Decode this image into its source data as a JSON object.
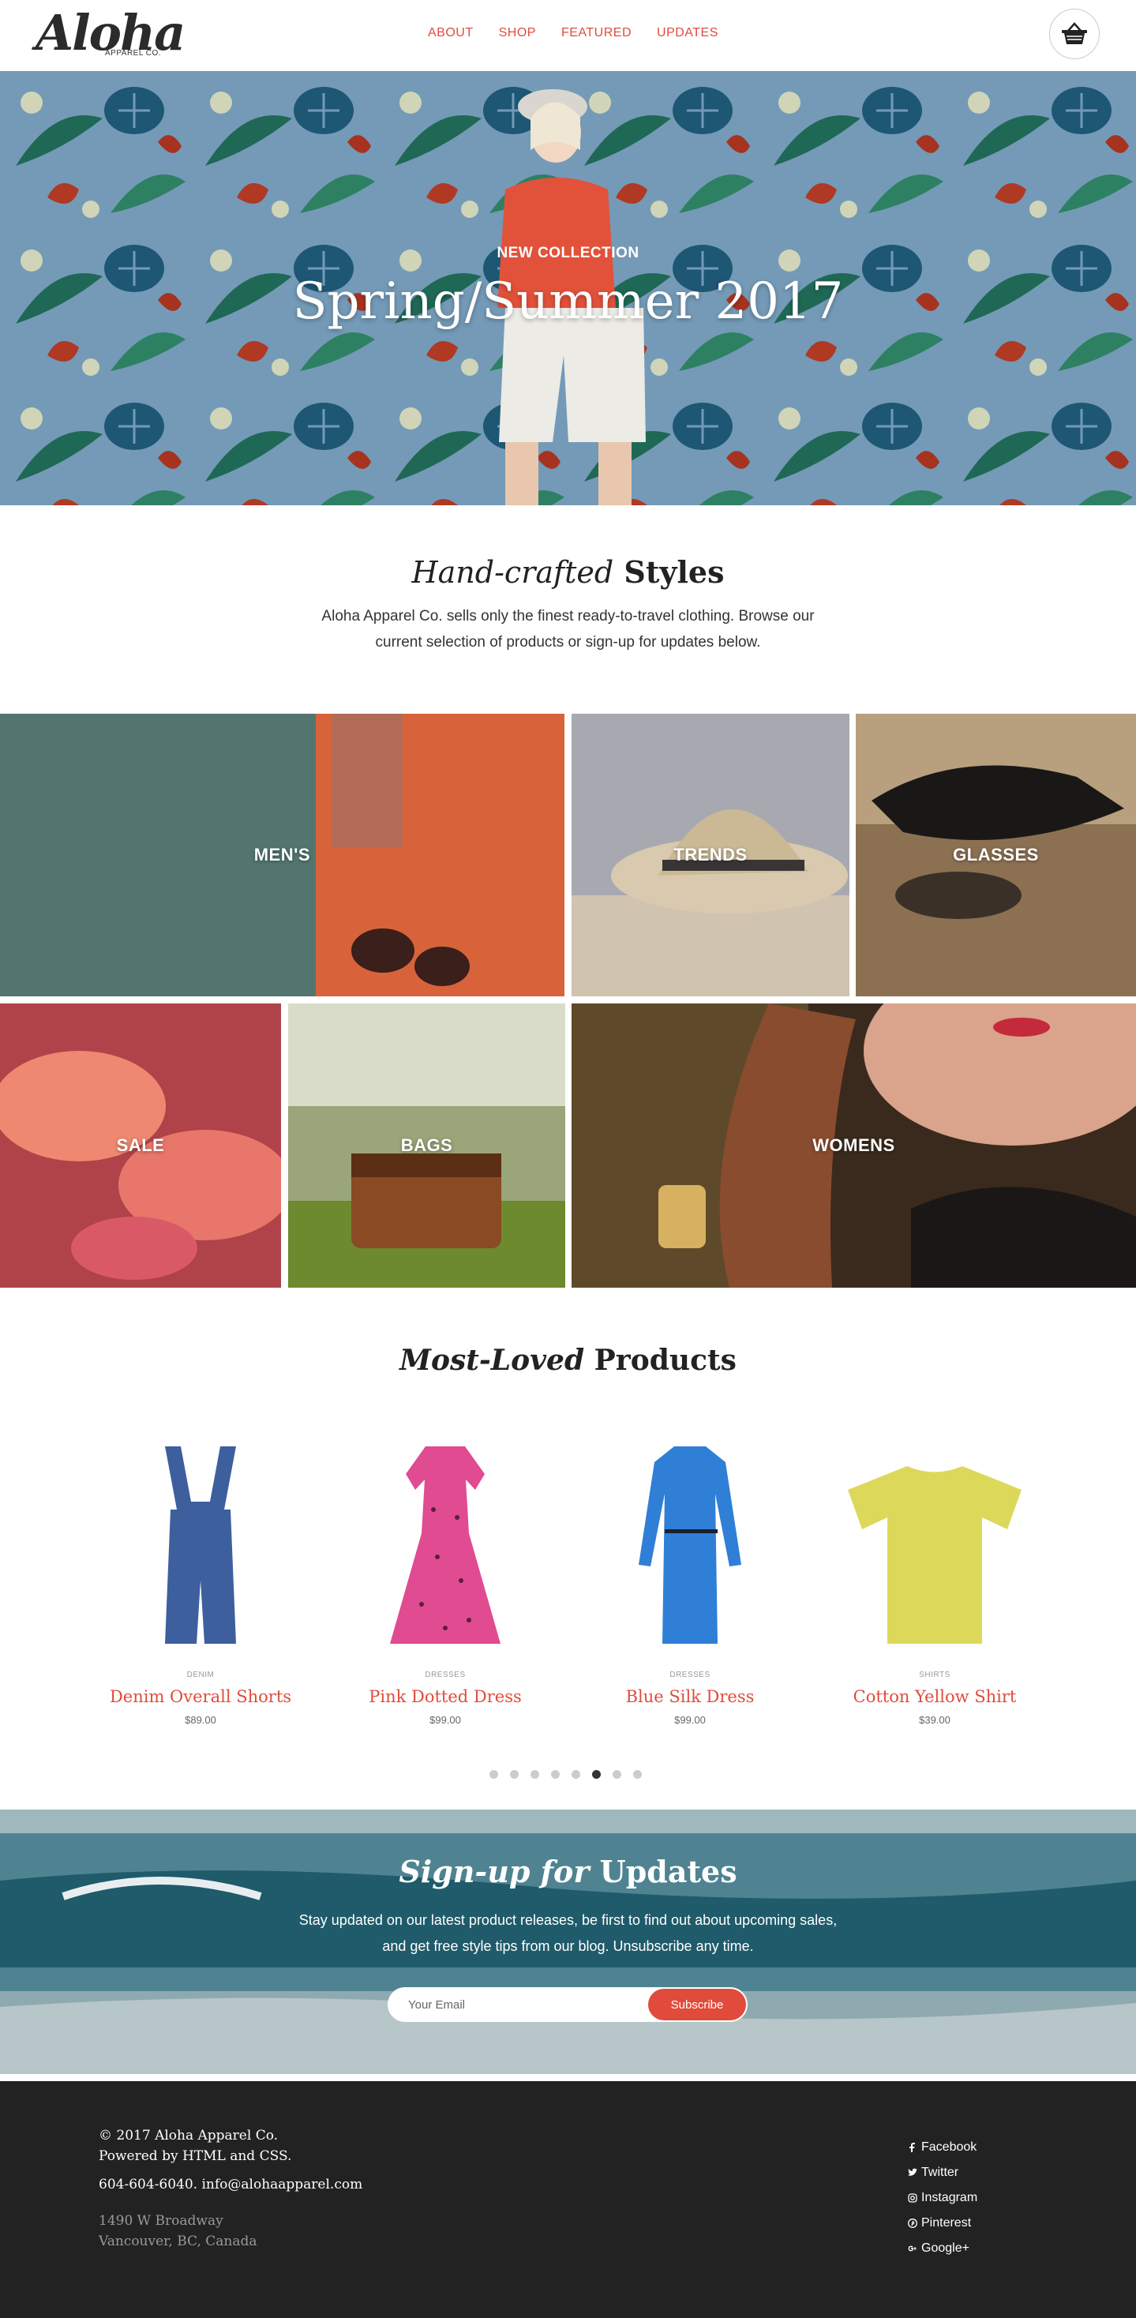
{
  "brand": {
    "logo_text": "Aloha",
    "logo_sub": "APPAREL CO."
  },
  "nav": {
    "items": [
      "ABOUT",
      "SHOP",
      "FEATURED",
      "UPDATES"
    ]
  },
  "cart": {
    "icon": "basket-icon"
  },
  "hero": {
    "kicker": "NEW COLLECTION",
    "title": "Spring/Summer 2017"
  },
  "intro": {
    "title_italic": "Hand-crafted",
    "title_bold": "Styles",
    "body": "Aloha Apparel Co. sells only the finest ready-to-travel clothing. Browse our current selection of products or sign-up for updates below."
  },
  "categories": [
    "MEN'S",
    "TRENDS",
    "GLASSES",
    "SALE",
    "BAGS",
    "WOMENS"
  ],
  "products_section": {
    "title_italic": "Most-Loved",
    "title_bold": "Products"
  },
  "products": [
    {
      "category": "DENIM",
      "name": "Denim Overall Shorts",
      "price": "$89.00",
      "color": "#3d5f9e"
    },
    {
      "category": "DRESSES",
      "name": "Pink Dotted Dress",
      "price": "$99.00",
      "color": "#e04b92"
    },
    {
      "category": "DRESSES",
      "name": "Blue Silk Dress",
      "price": "$99.00",
      "color": "#2f7fd6"
    },
    {
      "category": "SHIRTS",
      "name": "Cotton Yellow Shirt",
      "price": "$39.00",
      "color": "#dcd95a"
    }
  ],
  "carousel": {
    "total": 8,
    "active": 5
  },
  "signup": {
    "title_italic": "Sign-up for",
    "title_bold": "Updates",
    "body": "Stay updated on our latest product releases, be first to find out about upcoming sales, and get free style tips from our blog. Unsubscribe any time.",
    "placeholder": "Your Email",
    "button": "Subscribe"
  },
  "footer": {
    "copyright": "© 2017 Aloha Apparel Co.",
    "powered": "Powered by HTML and CSS.",
    "phone": "604-604-6040.",
    "email": "info@alohaapparel.com",
    "address1": "1490 W Broadway",
    "address2": "Vancouver, BC, Canada",
    "social": [
      {
        "label": "Facebook",
        "icon": "facebook-icon"
      },
      {
        "label": "Twitter",
        "icon": "twitter-icon"
      },
      {
        "label": "Instagram",
        "icon": "instagram-icon"
      },
      {
        "label": "Pinterest",
        "icon": "pinterest-icon"
      },
      {
        "label": "Google+",
        "icon": "google-plus-icon"
      }
    ]
  },
  "colors": {
    "accent": "#e14b3b",
    "footer_bg": "#222222"
  }
}
